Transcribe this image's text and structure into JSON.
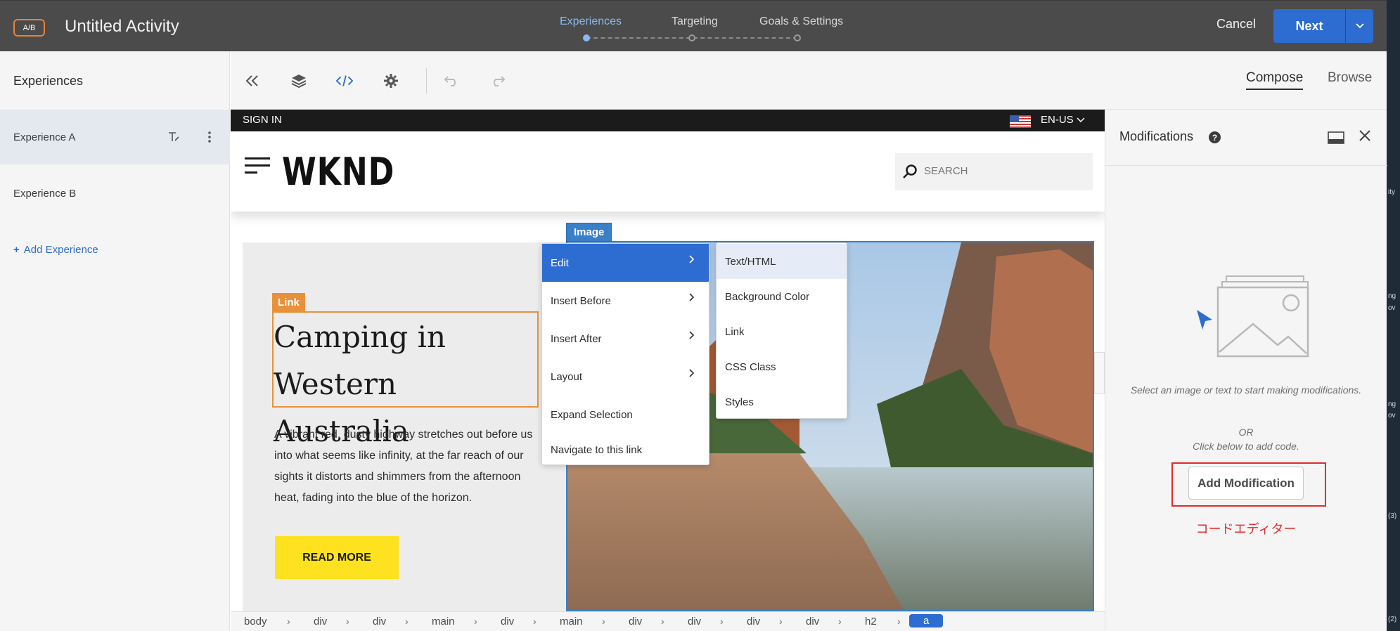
{
  "topbar": {
    "badge": "A/B",
    "activity_title": "Untitled Activity",
    "steps": [
      {
        "label": "Experiences",
        "active": true
      },
      {
        "label": "Targeting",
        "active": false
      },
      {
        "label": "Goals & Settings",
        "active": false
      }
    ],
    "cancel_label": "Cancel",
    "next_label": "Next"
  },
  "right_strip": [
    "ity",
    "ng",
    "ov",
    "ng",
    "ov",
    "(3)",
    "(2)"
  ],
  "experiences": {
    "title": "Experiences",
    "items": [
      {
        "label": "Experience A",
        "selected": true
      },
      {
        "label": "Experience B",
        "selected": false
      }
    ],
    "add_label": "Add Experience"
  },
  "toolbar": {
    "icons": [
      "collapse-icon",
      "layers-icon",
      "code-icon",
      "settings-icon",
      "undo-icon",
      "redo-icon"
    ],
    "modes": [
      {
        "label": "Compose",
        "active": true
      },
      {
        "label": "Browse",
        "active": false
      }
    ]
  },
  "site": {
    "signin": "SIGN IN",
    "language": "EN-US",
    "logo": "WKND",
    "search_placeholder": "SEARCH",
    "image_label": "Image",
    "link_label": "Link",
    "headline": "Camping in Western Australia",
    "paragraph": "A vibrant red, dusty highway stretches out before us into what seems like infinity, at the far reach of our sights it distorts and shimmers from the afternoon heat, fading into the blue of the horizon.",
    "read_more": "READ MORE"
  },
  "context_menu": {
    "items": [
      {
        "label": "Edit",
        "has_submenu": true,
        "selected": true
      },
      {
        "label": "Insert Before",
        "has_submenu": true,
        "selected": false
      },
      {
        "label": "Insert After",
        "has_submenu": true,
        "selected": false
      },
      {
        "label": "Layout",
        "has_submenu": true,
        "selected": false
      },
      {
        "label": "Expand Selection",
        "has_submenu": false,
        "selected": false
      },
      {
        "label": "Navigate to this link",
        "has_submenu": false,
        "selected": false
      }
    ],
    "submenu": [
      {
        "label": "Text/HTML",
        "selected": true
      },
      {
        "label": "Background Color",
        "selected": false
      },
      {
        "label": "Link",
        "selected": false
      },
      {
        "label": "CSS Class",
        "selected": false
      },
      {
        "label": "Styles",
        "selected": false
      }
    ]
  },
  "breadcrumb": [
    "body",
    "div",
    "div",
    "main",
    "div",
    "main",
    "div",
    "div",
    "div",
    "div",
    "h2",
    "a"
  ],
  "modifications": {
    "title": "Modifications",
    "help": "?",
    "hint": "Select an image or text to start making modifications.",
    "or_text": "OR",
    "code_hint": "Click below to add code.",
    "add_button": "Add Modification",
    "annotation": "コードエディター"
  },
  "colors": {
    "topbar": "#4b4b4b",
    "accent_blue": "#2d6cd0",
    "link_orange": "#e8913a",
    "annotation_red": "#e52a2a",
    "read_more_yellow": "#ffe21f"
  }
}
